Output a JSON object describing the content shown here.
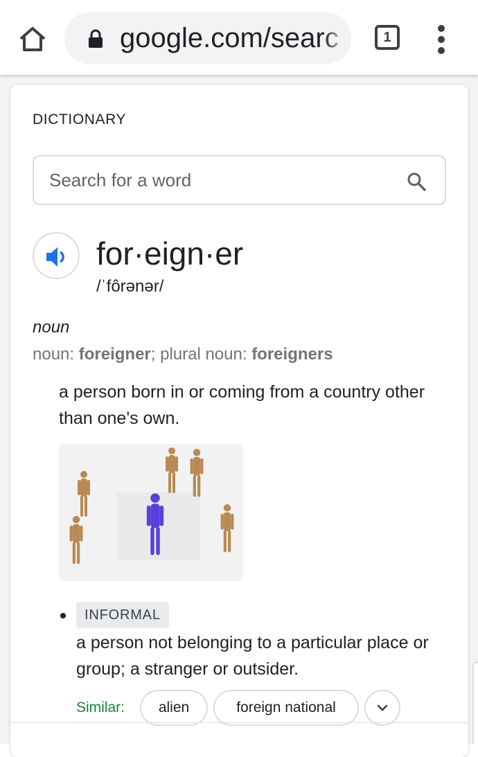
{
  "browser": {
    "url": "google.com/searc",
    "tab_count": "1",
    "icons": {
      "home": "home-icon",
      "lock": "lock-icon",
      "menu": "more-vert-icon"
    }
  },
  "dictionary": {
    "section_label": "DICTIONARY",
    "search": {
      "placeholder": "Search for a word",
      "value": ""
    },
    "entry": {
      "headword": "for·eign·er",
      "phonetic": "/ˈfôrənər/",
      "part_of_speech": "noun",
      "forms": {
        "noun_label": "noun: ",
        "noun": "foreigner",
        "sep": "; ",
        "plural_label": "plural noun: ",
        "plural": "foreigners"
      },
      "definitions": [
        {
          "text": "a person born in or coming from a country other than one's own."
        },
        {
          "tag": "INFORMAL",
          "text": "a person not belonging to a particular place or group; a stranger or outsider."
        }
      ],
      "similar_label": "Similar:",
      "similar": [
        "alien",
        "foreign national"
      ]
    }
  },
  "colors": {
    "accent_blue": "#1a73e8",
    "similar_green": "#188038",
    "muted_text": "#70757a",
    "figure_wood": "#b98a55",
    "figure_blue": "#5a3fd8"
  }
}
